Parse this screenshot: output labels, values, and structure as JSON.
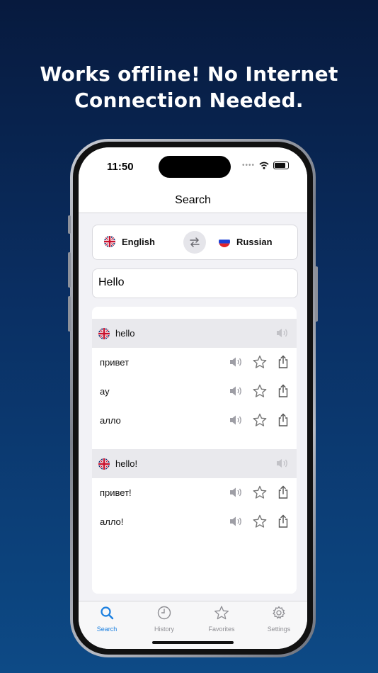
{
  "headline": {
    "line1": "Works offline! No Internet",
    "line2": "Connection Needed."
  },
  "status_bar": {
    "time": "11:50"
  },
  "nav": {
    "title": "Search"
  },
  "languages": {
    "source": "English",
    "target": "Russian"
  },
  "search": {
    "value": "Hello"
  },
  "results": [
    {
      "term": "hello",
      "translations": [
        "привет",
        "ау",
        "алло"
      ]
    },
    {
      "term": "hello!",
      "translations": [
        "привет!",
        "алло!"
      ]
    }
  ],
  "tabs": [
    {
      "label": "Search",
      "icon": "search-icon",
      "active": true
    },
    {
      "label": "History",
      "icon": "clock-icon",
      "active": false
    },
    {
      "label": "Favorites",
      "icon": "star-icon",
      "active": false
    },
    {
      "label": "Settings",
      "icon": "gear-icon",
      "active": false
    }
  ],
  "colors": {
    "accent": "#1a7fe0",
    "background_top": "#071a3e",
    "background_bottom": "#0d4a86"
  }
}
